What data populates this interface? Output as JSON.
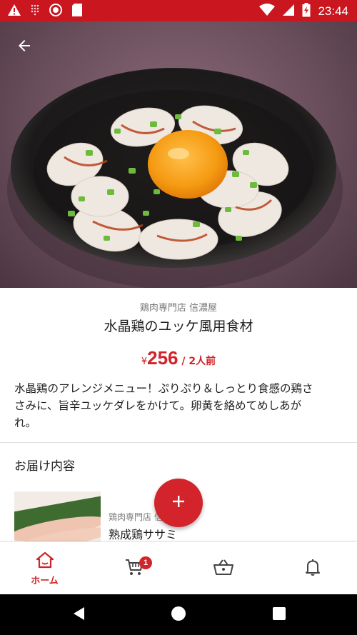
{
  "status_bar": {
    "time": "23:44",
    "background_color": "#c9161f",
    "icons_left": [
      "warning-icon",
      "grid-icon",
      "record-icon",
      "sd-card-icon"
    ],
    "icons_right": [
      "wifi-icon",
      "signal-icon",
      "battery-charging-icon"
    ]
  },
  "hero": {
    "back_icon": "arrow-left-icon"
  },
  "product": {
    "store": "鶏肉専門店 信濃屋",
    "title": "水晶鶏のユッケ風用食材",
    "price_prefix": "¥",
    "price": "256",
    "price_suffix": " / 2人前",
    "description": "水晶鶏のアレンジメニュー！ぷりぷり＆しっとり食感の鶏ささみに、旨辛ユッケダレをかけて。卵黄を絡めてめしあがれ。",
    "accent_color": "#d0232a"
  },
  "delivery": {
    "section_title": "お届け内容",
    "items": [
      {
        "store": "鶏肉専門店 信濃屋",
        "name": "熟成鶏ササミ"
      }
    ]
  },
  "fab": {
    "icon": "plus-icon"
  },
  "bottom_nav": {
    "items": [
      {
        "label": "ホーム",
        "icon": "home-icon",
        "active": true
      },
      {
        "label": "",
        "icon": "cart-icon",
        "badge": "1"
      },
      {
        "label": "",
        "icon": "basket-icon"
      },
      {
        "label": "",
        "icon": "bell-icon"
      }
    ]
  },
  "system_nav": {
    "buttons": [
      "back-triangle-icon",
      "home-circle-icon",
      "recents-square-icon"
    ]
  }
}
